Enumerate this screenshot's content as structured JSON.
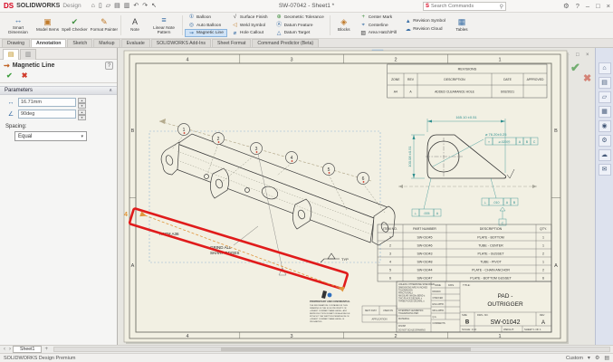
{
  "titlebar": {
    "logo": "DS",
    "app_name": "SOLIDWORKS",
    "app_edition": "Design",
    "document_title": "SW-07042 - Sheet1 *",
    "search_placeholder": "Search Commands"
  },
  "icons": {
    "home": "⌂",
    "new_doc": "▯",
    "open_doc": "▱",
    "save": "▤",
    "print": "▥",
    "undo": "↶",
    "redo": "↷",
    "select": "↖",
    "search": "⚲",
    "settings": "⚙",
    "help": "?",
    "minimize": "–",
    "restore": "□",
    "close": "×",
    "smart_dimension": "↔",
    "model_items": "▣",
    "spell_checker": "✔",
    "format_painter": "✎",
    "note": "A",
    "linear_note_pattern": "≡",
    "balloon": "①",
    "auto_balloon": "◎",
    "magnetic_line": "⇝",
    "surface_finish": "√",
    "weld_symbol": "◁",
    "hole_callout": "⌀",
    "geometric_tolerance": "⊕",
    "datum_feature": "Ⓐ",
    "datum_target": "△",
    "blocks": "◈",
    "center_mark": "+",
    "centerline": "⌖",
    "area_hatch": "▨",
    "revision_symbol": "▲",
    "revision_cloud": "☁",
    "tables": "▦",
    "pm_tab1": "▤",
    "pm_tab2": "▥",
    "pm_check": "✔",
    "pm_cancel": "✖",
    "pm_help": "?",
    "length": "↔",
    "angle": "∠",
    "collapse": "∧",
    "dropdown": "▾",
    "headsup": [
      "⚲",
      "▢",
      "↻",
      "◔",
      "▤",
      "◻",
      "⌖",
      "▾"
    ],
    "taskpane": [
      "⌂",
      "▤",
      "▱",
      "▦",
      "◉",
      "⚙",
      "☁",
      "✉"
    ],
    "doc_controls": [
      "▫",
      "–",
      "□",
      "×"
    ],
    "sheet_prev": "‹",
    "sheet_next": "›",
    "add_sheet": "+",
    "status_icon1": "⚙",
    "status_icon2": "▤"
  },
  "toolbar": {
    "smart_dimension": "Smart Dimension",
    "model_items": "Model Items",
    "spell_checker": "Spell Checker",
    "format_painter": "Format Painter",
    "note": "Note",
    "linear_note_pattern": "Linear Note Pattern",
    "balloon": "Balloon",
    "auto_balloon": "Auto Balloon",
    "magnetic_line": "Magnetic Line",
    "surface_finish": "Surface Finish",
    "weld_symbol": "Weld Symbol",
    "hole_callout": "Hole Callout",
    "geometric_tolerance": "Geometric Tolerance",
    "datum_feature": "Datum Feature",
    "datum_target": "Datum Target",
    "blocks": "Blocks",
    "center_mark": "Center Mark",
    "centerline": "Centerline",
    "area_hatch": "Area Hatch/Fill",
    "revision_symbol": "Revision Symbol",
    "revision_cloud": "Revision Cloud",
    "tables": "Tables"
  },
  "tabs": [
    "Drawing",
    "Annotation",
    "Sketch",
    "Markup",
    "Evaluate",
    "SOLIDWORKS Add-Ins",
    "Sheet Format",
    "Command Predictor (Beta)"
  ],
  "property_manager": {
    "title": "Magnetic Line",
    "parameters_label": "Parameters",
    "length_value": "16.71mm",
    "angle_value": "90deg",
    "spacing_label": "Spacing:",
    "spacing_value": "Equal"
  },
  "sheet": {
    "zones_top": [
      "4",
      "3",
      "2",
      "1"
    ],
    "zones_bottom": [
      "4",
      "3",
      "2",
      "1"
    ],
    "zones_left": [
      "B",
      "A"
    ],
    "zones_right": [
      "B",
      "A"
    ],
    "balloons": [
      "1",
      "2",
      "3",
      "4",
      "5",
      "6"
    ],
    "markup_number": "4",
    "notes": {
      "material": "ASTM A36",
      "grind1": "GRIND ALL",
      "grind2": "SHARP EDGES",
      "weld": "TYP"
    },
    "revisions": {
      "title": "REVISIONS",
      "headers": [
        "ZONE",
        "REV",
        "DESCRIPTION",
        "DATE",
        "APPROVED"
      ],
      "rows": [
        [
          "A4",
          "A",
          "ADDED CLEARANCE HOLE",
          "6/02/2021",
          ""
        ]
      ]
    },
    "detail": {
      "dim_width": "165.10 ±0.51",
      "dim_height": "100.08 ±0.51",
      "hole_callout": "⌀ 76.20±0.25",
      "fcf_pos_sym": "⌖",
      "fcf_pos_tol": "⌀.020Ⓜ",
      "fcf_pos_d1": "A",
      "fcf_pos_d2": "B",
      "fcf_pos_d3": "C",
      "fcf1_sym": "⊥",
      "fcf1_tol": ".010",
      "fcf1_d1": "A",
      "fcf1_d2": "B",
      "fcf2_sym": "⊥",
      "fcf2_tol": ".005",
      "fcf2_d1": "A",
      "datum": "C"
    },
    "bom": {
      "headers": [
        "ITEM NO.",
        "PART NUMBER",
        "DESCRIPTION",
        "QTY."
      ],
      "rows": [
        [
          "1",
          "SW-01045",
          "PLATE - BOTTOM",
          "1"
        ],
        [
          "2",
          "SW-01046",
          "TUBE - CENTER",
          "1"
        ],
        [
          "3",
          "SW-01043",
          "PLATE - GUSSET",
          "2"
        ],
        [
          "4",
          "SW-01048",
          "TUBE - PIVOT",
          "1"
        ],
        [
          "5",
          "SW-01044",
          "PLATE - CHAIN ANCHOR",
          "2"
        ],
        [
          "6",
          "SW-01047",
          "PLATE - BOTTOM GUSSET",
          "6"
        ]
      ]
    },
    "title_block": {
      "title_label": "TITLE:",
      "title_line1": "PAD -",
      "title_line2": "OUTRIGGER",
      "size_label": "SIZE",
      "size": "B",
      "dwg_label": "DWG.  NO.",
      "dwg_no": "SW-01042",
      "rev_label": "REV",
      "rev": "A",
      "scale": "SCALE: 1:10",
      "weight": "WEIGHT:",
      "sheet_of": "SHEET 1 OF 1",
      "name_h": "NAME",
      "date_h": "DATE",
      "sign_rows": [
        "DRAWN",
        "CHECKED",
        "ENG APPR.",
        "MFG APPR.",
        "Q.A.",
        "COMMENTS:"
      ],
      "tol1": "UNLESS OTHERWISE SPECIFIED:",
      "tol2": "DIMENSIONS ARE IN INCHES",
      "tol3": "TOLERANCES:",
      "tol4": "FRACTIONAL±",
      "tol5": "ANGULAR: MACH±  BEND ±",
      "tol6": "TWO PLACE DECIMAL    ±",
      "tol7": "THREE PLACE DECIMAL  ±",
      "interpret1": "INTERPRET GEOMETRIC",
      "interpret2": "TOLERANCING PER:",
      "material_label": "MATERIAL",
      "finish_label": "FINISH",
      "do_not_scale": "DO NOT SCALE DRAWING",
      "prop1": "PROPRIETARY AND CONFIDENTIAL",
      "prop2": "THE INFORMATION CONTAINED IN THIS",
      "prop3": "DRAWING IS THE SOLE PROPERTY OF",
      "prop4": "<INSERT COMPANY NAME HERE>. ANY",
      "prop5": "REPRODUCTION IN PART OR AS A WHOLE",
      "prop6": "WITHOUT THE WRITTEN PERMISSION OF",
      "prop7": "<INSERT COMPANY NAME HERE> IS",
      "prop8": "PROHIBITED.",
      "next_assy": "NEXT ASSY",
      "used_on": "USED ON",
      "application": "APPLICATION"
    }
  },
  "sheet_tabs": {
    "sheet1": "Sheet1"
  },
  "statusbar": {
    "left": "SOLIDWORKS Design Premium",
    "custom": "Custom"
  }
}
